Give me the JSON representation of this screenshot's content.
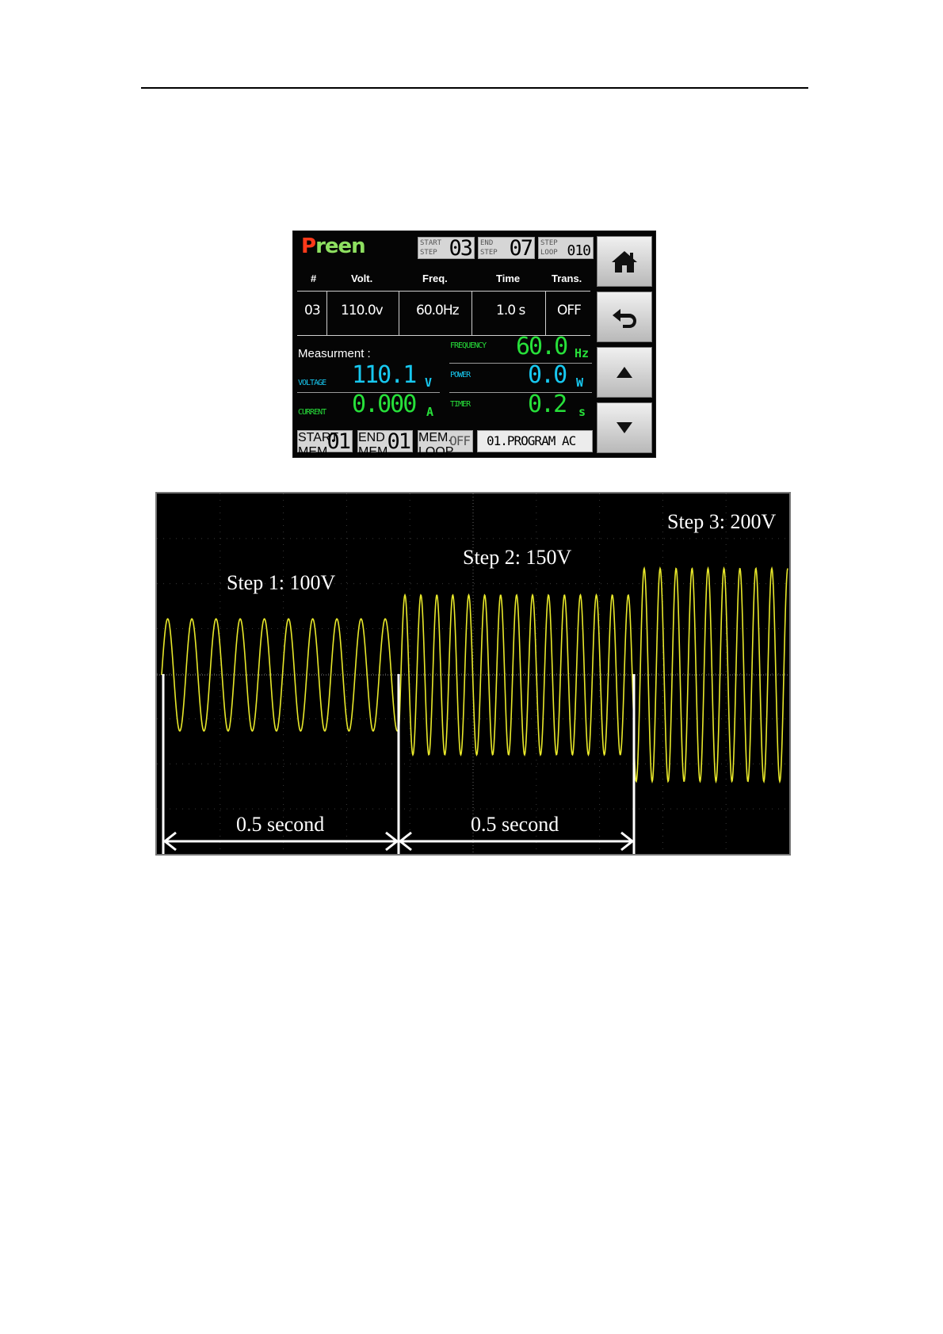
{
  "panel": {
    "brand_first": "P",
    "brand_rest": "reen",
    "start_step": {
      "cap1": "START",
      "cap2": "STEP",
      "value": "03"
    },
    "end_step": {
      "cap1": "END",
      "cap2": "STEP",
      "value": "07"
    },
    "step_loop": {
      "cap1": "STEP",
      "cap2": "LOOP",
      "value": "010"
    },
    "table": {
      "headers": {
        "index": "#",
        "volt": "Volt.",
        "freq": "Freq.",
        "time": "Time",
        "trans": "Trans."
      },
      "row": {
        "index": "03",
        "volt": "110.0v",
        "freq": "60.0Hz",
        "time": "1.0 s",
        "trans": "OFF"
      }
    },
    "measurement": {
      "label": "Measurment :",
      "frequency": {
        "label": "FREQUENCY",
        "value": "60.0",
        "unit": "Hz"
      },
      "voltage": {
        "label": "VOLTAGE",
        "value": "110.1",
        "unit": "V"
      },
      "power": {
        "label": "POWER",
        "value": "0.0",
        "unit": "W"
      },
      "current": {
        "label": "CURRENT",
        "value": "0.000",
        "unit": "A"
      },
      "timer": {
        "label": "TIMER",
        "value": "0.2",
        "unit": "s"
      }
    },
    "start_mem": {
      "cap1": "START",
      "cap2": "MEM.",
      "value": "01"
    },
    "end_mem": {
      "cap1": "END",
      "cap2": "MEM.",
      "value": "01"
    },
    "mem_loop": {
      "cap1": "MEM.",
      "cap2": "LOOP",
      "value": "OFF"
    },
    "program": "01.PROGRAM AC",
    "buttons": {
      "home": "home-icon",
      "back": "back-arrow-icon",
      "up": "triangle-up-icon",
      "down": "triangle-down-icon"
    }
  },
  "scope": {
    "trace_color": "#e8e82a",
    "steps": [
      {
        "label": "Step 1: 100V",
        "volts": 100
      },
      {
        "label": "Step 2: 150V",
        "volts": 150
      },
      {
        "label": "Step 3: 200V",
        "volts": 200
      }
    ],
    "durations": [
      "0.5 second",
      "0.5 second"
    ]
  }
}
